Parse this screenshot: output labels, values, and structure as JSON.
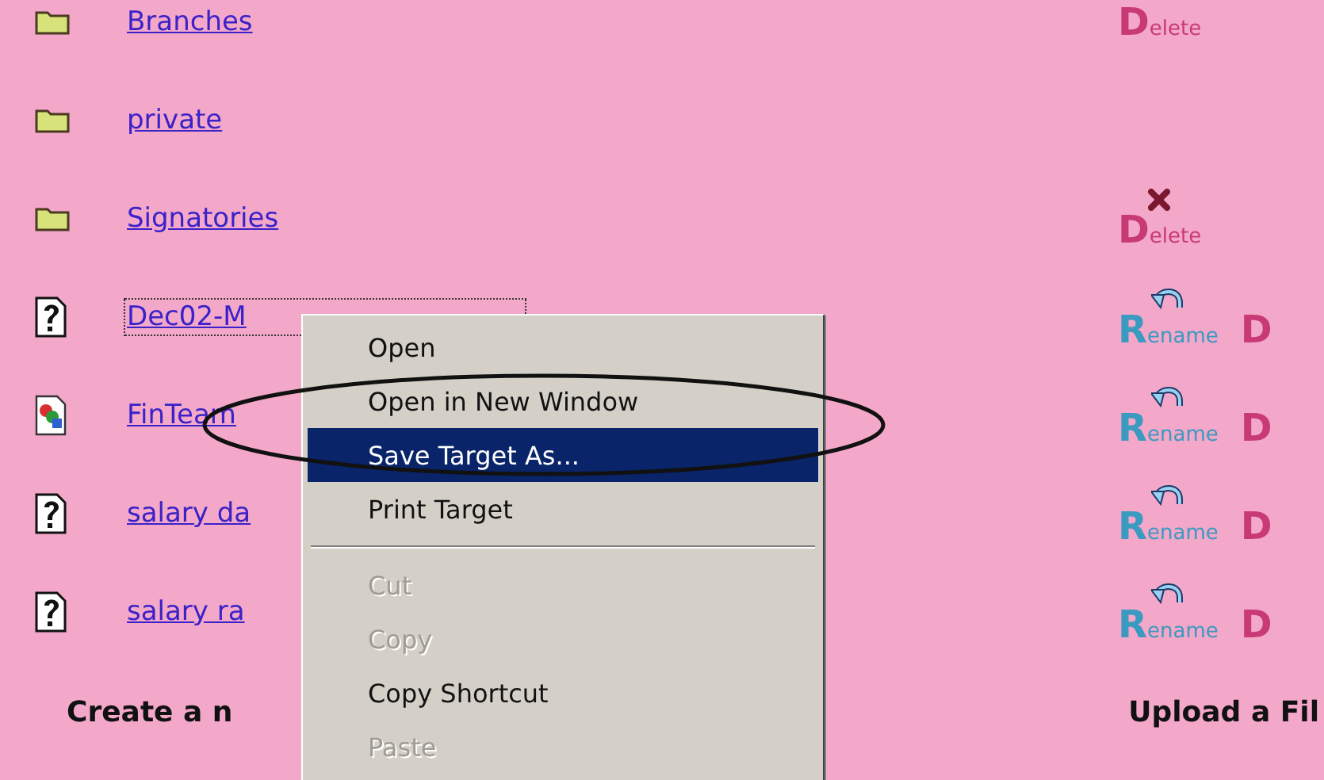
{
  "files": [
    {
      "kind": "folder",
      "name": "Branches",
      "focused": false,
      "actions": [
        {
          "kind": "delete",
          "label": "Delete",
          "icon": false
        }
      ]
    },
    {
      "kind": "folder",
      "name": "private",
      "focused": false
    },
    {
      "kind": "folder",
      "name": "Signatories",
      "focused": false,
      "actions": [
        {
          "kind": "delete",
          "label": "Delete",
          "icon": true
        }
      ]
    },
    {
      "kind": "unknown",
      "name": "Dec02-M",
      "focused": true,
      "actions": [
        {
          "kind": "rename",
          "label": "Rename",
          "icon": true
        },
        {
          "kind": "delete",
          "label": "D",
          "icon": false
        }
      ]
    },
    {
      "kind": "image",
      "name": "FinTeam",
      "focused": false,
      "actions": [
        {
          "kind": "rename",
          "label": "Rename",
          "icon": true
        },
        {
          "kind": "delete",
          "label": "D",
          "icon": false
        }
      ]
    },
    {
      "kind": "unknown",
      "name": "salary da",
      "focused": false,
      "actions": [
        {
          "kind": "rename",
          "label": "Rename",
          "icon": true
        },
        {
          "kind": "delete",
          "label": "D",
          "icon": false
        }
      ]
    },
    {
      "kind": "unknown",
      "name": "salary ra",
      "focused": false,
      "actions": [
        {
          "kind": "rename",
          "label": "Rename",
          "icon": true
        },
        {
          "kind": "delete",
          "label": "D",
          "icon": false
        }
      ]
    }
  ],
  "footer": {
    "create_heading": "Create a n",
    "upload_heading": "Upload a Fil"
  },
  "context_menu": {
    "items": [
      {
        "kind": "item",
        "label": "Open",
        "selected": false,
        "disabled": false
      },
      {
        "kind": "item",
        "label": "Open in New Window",
        "selected": false,
        "disabled": false
      },
      {
        "kind": "item",
        "label": "Save Target As...",
        "selected": true,
        "disabled": false
      },
      {
        "kind": "item",
        "label": "Print Target",
        "selected": false,
        "disabled": false
      },
      {
        "kind": "separator"
      },
      {
        "kind": "item",
        "label": "Cut",
        "selected": false,
        "disabled": true
      },
      {
        "kind": "item",
        "label": "Copy",
        "selected": false,
        "disabled": true
      },
      {
        "kind": "item",
        "label": "Copy Shortcut",
        "selected": false,
        "disabled": false
      },
      {
        "kind": "item",
        "label": "Paste",
        "selected": false,
        "disabled": true
      }
    ]
  },
  "highlight_ellipse": true
}
